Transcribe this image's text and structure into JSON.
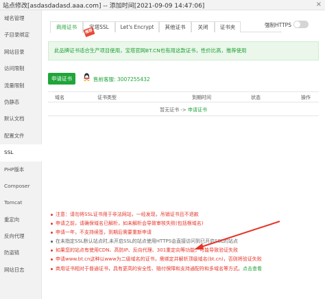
{
  "window": {
    "title": "站点修改[asdasdadasd.aaa.com] -- 添加时间[2021-09-09 14:47:06]",
    "close_glyph": "×"
  },
  "sidebar": {
    "items": [
      {
        "label": "域名管理"
      },
      {
        "label": "子目录绑定"
      },
      {
        "label": "网站目录"
      },
      {
        "label": "访问限制"
      },
      {
        "label": "流量限制"
      },
      {
        "label": "伪静态"
      },
      {
        "label": "默认文档"
      },
      {
        "label": "配置文件"
      },
      {
        "label": "SSL",
        "active": true
      },
      {
        "label": "PHP版本"
      },
      {
        "label": "Composer"
      },
      {
        "label": "Tomcat"
      },
      {
        "label": "重定向"
      },
      {
        "label": "反向代理"
      },
      {
        "label": "防盗链"
      },
      {
        "label": "网站日志"
      }
    ]
  },
  "tabs": [
    {
      "label": "商用证书",
      "active": true
    },
    {
      "label": "宝塔SSL"
    },
    {
      "label": "Let's Encrypt"
    },
    {
      "label": "其他证书"
    },
    {
      "label": "关闭"
    },
    {
      "label": "证书夹"
    }
  ],
  "tab_badge": "推荐",
  "force_https": {
    "label": "强制HTTPS",
    "enabled": false
  },
  "notice": "此品牌证书适合生产项目使用，宝塔官网BT.CN也有用这款证书，性价比高，推荐使用",
  "apply_button": "申请证书",
  "support": {
    "icon": "qq-icon",
    "text": "售前客服: 3007255432"
  },
  "table": {
    "columns": [
      "域名",
      "证书类型",
      "到期时间",
      "状态",
      "操作"
    ],
    "empty_prefix": "暂无证书 -> ",
    "empty_link": "申请证书"
  },
  "tips": [
    {
      "text": "注意：请勿将SSL证书用于非法网站，一经发现，吊销证书且不退款",
      "style": "red"
    },
    {
      "text": "申请之前，请确保域名已解析，如未解析会导致审核失败(包括根域名)",
      "style": "red"
    },
    {
      "text": "申请一年，不支持续签，到期后需要重新申请",
      "style": "red"
    },
    {
      "text": "在未指定SSL默认站点时,未开启SSL的站点使用HTTPS会直接访问到已开启SSL的站点",
      "style": "gray"
    },
    {
      "text": "如果您的站点有使用CDN、高防IP、反向代理、301重定向等功能，可能导致验证失败",
      "style": "red"
    },
    {
      "text": "申请www.bt.cn这种以www为二级域名的证书，需绑定并解析顶级域名(bt.cn)，否则将验证失败",
      "style": "red"
    },
    {
      "text": "商用证书相对于普通证书，具有更高的安全性、赔付保障和支持通配符和多域名等方式。",
      "style": "red",
      "link": "点击查看"
    }
  ],
  "colors": {
    "accent": "#20a53a",
    "warning": "#e53428",
    "annotation_arrow": "#e53428"
  }
}
